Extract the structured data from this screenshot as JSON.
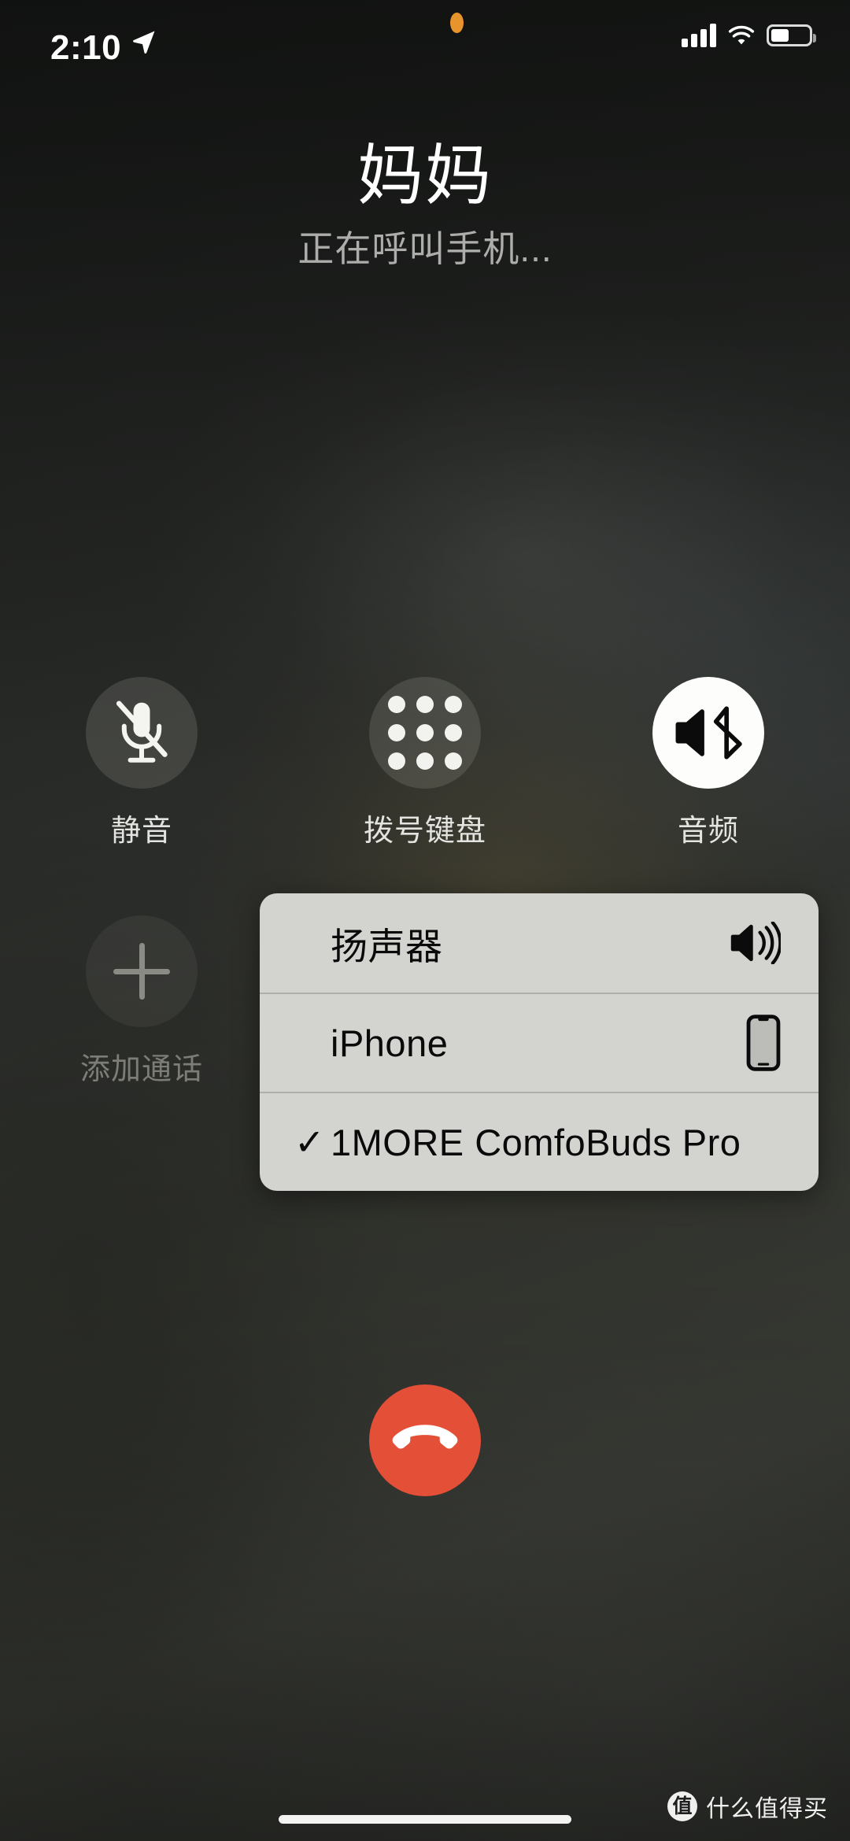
{
  "status_bar": {
    "time": "2:10",
    "location_icon": "location-arrow-icon",
    "privacy_dot": "microphone-in-use-dot",
    "cellular_icon": "cellular-signal-icon",
    "wifi_icon": "wifi-icon",
    "battery_icon": "battery-icon",
    "battery_level_percent": 48
  },
  "call": {
    "contact_name": "妈妈",
    "status_text": "正在呼叫手机...",
    "end_call_label": "end-call",
    "end_call_color": "#e44f37"
  },
  "controls": [
    {
      "id": "mute",
      "label": "静音",
      "icon": "microphone-slash-icon",
      "state": "inactive"
    },
    {
      "id": "keypad",
      "label": "拨号键盘",
      "icon": "dialpad-icon",
      "state": "inactive"
    },
    {
      "id": "audio",
      "label": "音频",
      "icon": "speaker-bluetooth-icon",
      "state": "active"
    },
    {
      "id": "add_call",
      "label": "添加通话",
      "icon": "plus-icon",
      "state": "disabled"
    }
  ],
  "audio_route_menu": {
    "background_color": "#d3d3cf",
    "items": [
      {
        "label": "扬声器",
        "icon": "speaker-waves-icon",
        "selected": false,
        "check": ""
      },
      {
        "label": "iPhone",
        "icon": "iphone-device-icon",
        "selected": false,
        "check": ""
      },
      {
        "label": "1MORE ComfoBuds Pro",
        "icon": "",
        "selected": true,
        "check": "✓"
      }
    ]
  },
  "watermark": {
    "logo_char": "值",
    "text": "什么值得买"
  }
}
